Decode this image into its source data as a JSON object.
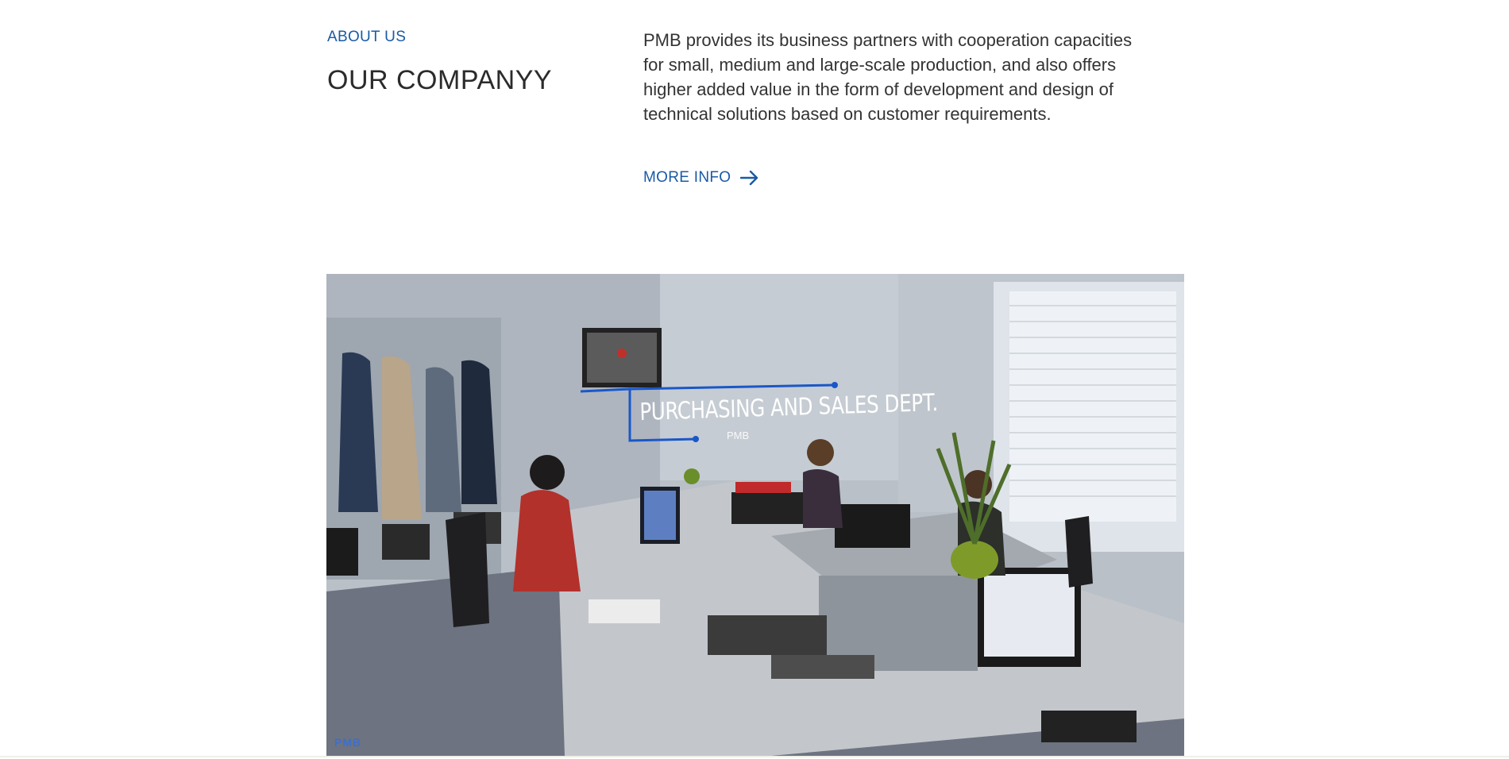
{
  "about": {
    "label": "ABOUT US",
    "title": "OUR COMPANYY",
    "description": "PMB provides its business partners with cooperation capacities for small, medium and large-scale production, and also offers higher added value in the form of development and design of technical solutions based on customer requirements.",
    "more_info_label": "MORE INFO",
    "more_info_icon": "arrow-right-icon"
  },
  "video": {
    "overlay_title": "PURCHASING AND SALES DEPT.",
    "overlay_subtitle": "PMB",
    "watermark": "PMB"
  },
  "colors": {
    "accent": "#1a5aa6",
    "heading": "#2b2b2b",
    "body_text": "#333333"
  }
}
